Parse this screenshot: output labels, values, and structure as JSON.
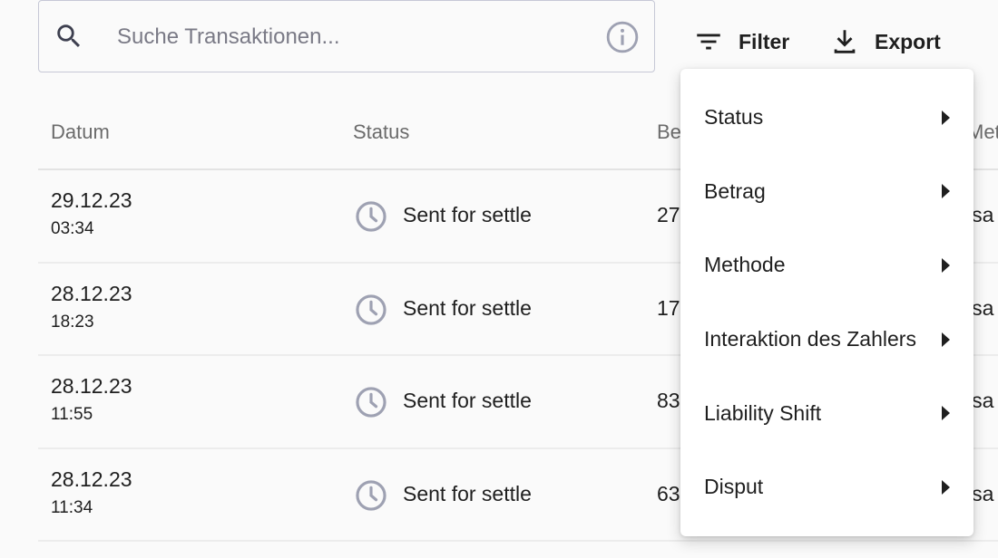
{
  "search": {
    "placeholder": "Suche Transaktionen..."
  },
  "toolbar": {
    "filter_label": "Filter",
    "export_label": "Export"
  },
  "table": {
    "columns": {
      "date": "Datum",
      "status": "Status",
      "amount": "Be",
      "method": "Met"
    },
    "rows": [
      {
        "date": "29.12.23",
        "time": "03:34",
        "status": "Sent for settle",
        "amount": "27",
        "method": "isa"
      },
      {
        "date": "28.12.23",
        "time": "18:23",
        "status": "Sent for settle",
        "amount": "17",
        "method": "isa"
      },
      {
        "date": "28.12.23",
        "time": "11:55",
        "status": "Sent for settle",
        "amount": "83",
        "method": "isa"
      },
      {
        "date": "28.12.23",
        "time": "11:34",
        "status": "Sent for settle",
        "amount": "63",
        "method": "isa"
      }
    ]
  },
  "filter_menu": {
    "items": [
      {
        "label": "Status"
      },
      {
        "label": "Betrag"
      },
      {
        "label": "Methode"
      },
      {
        "label": "Interaktion des Zahlers"
      },
      {
        "label": "Liability Shift"
      },
      {
        "label": "Disput"
      }
    ]
  },
  "icons": {
    "search": "search-icon",
    "info": "info-icon",
    "filter": "filter-icon",
    "export": "download-icon",
    "status": "clock-icon",
    "submenu": "caret-right-icon"
  },
  "colors": {
    "icon_gray": "#9ea1b2",
    "text_dark": "#1f1f1f",
    "header_text": "#6b6b6b",
    "border": "#c6c8d6"
  }
}
